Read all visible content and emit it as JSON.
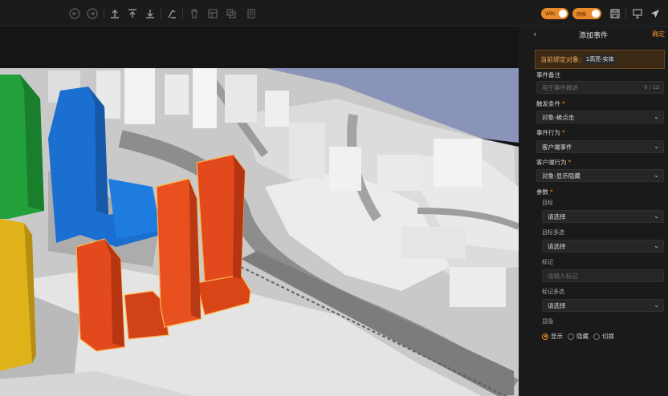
{
  "toolbar": {
    "left_icons": [
      "undo-icon",
      "redo-icon",
      "upload-icon",
      "move-top-icon",
      "download-icon",
      "clear-icon",
      "delete-icon",
      "group-icon",
      "copy-icon",
      "paste-icon"
    ],
    "toggle_1": "WBL",
    "toggle_2": "网格",
    "right_icons": [
      "save-icon",
      "monitor-icon",
      "send-icon"
    ]
  },
  "panel": {
    "title": "添加事件",
    "back_icon": "back-chevron-icon",
    "confirm": "确定",
    "bound_label": "当前绑定对象:",
    "bound_tag": "1高亮-实体",
    "remark_label": "事件备注",
    "remark_placeholder": "用于事件概述",
    "remark_count": "0 / 12",
    "trigger_label": "触发条件",
    "trigger_value": "对象-被点击",
    "action_label": "事件行为",
    "action_value": "客户端事件",
    "client_label": "客户端行为",
    "client_value": "对象-显示隐藏",
    "params_label": "参数",
    "target_label": "目标",
    "target_value": "请选择",
    "target_multi_label": "目标多选",
    "target_multi_value": "请选择",
    "mark_label": "标记",
    "mark_placeholder": "请输入标记",
    "mark_multi_label": "标记多选",
    "mark_multi_value": "请选择",
    "visibility_label": "显隐",
    "options": [
      "显示",
      "隐藏",
      "切换"
    ],
    "selected_option": "显示"
  },
  "colors": {
    "accent": "#e8892a",
    "panel_bg": "#1a1a1b",
    "highlight_building": "#e2491c",
    "blue_building": "#1a6fd0",
    "green_building": "#22a03a",
    "yellow_building": "#e0b21a",
    "sky": "#8a93b8"
  }
}
